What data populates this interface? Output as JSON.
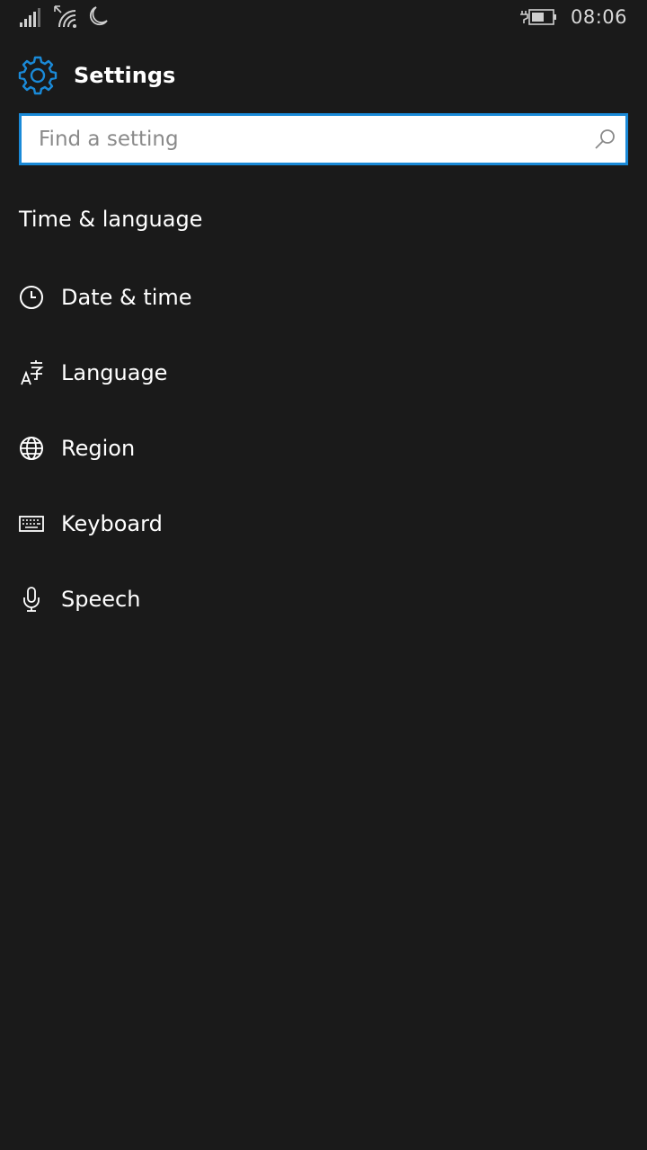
{
  "status": {
    "time": "08:06"
  },
  "header": {
    "title": "Settings"
  },
  "search": {
    "placeholder": "Find a setting",
    "value": ""
  },
  "section": {
    "title": "Time & language"
  },
  "menu": {
    "items": [
      {
        "label": "Date & time",
        "icon": "clock-icon"
      },
      {
        "label": "Language",
        "icon": "language-icon"
      },
      {
        "label": "Region",
        "icon": "globe-icon"
      },
      {
        "label": "Keyboard",
        "icon": "keyboard-icon"
      },
      {
        "label": "Speech",
        "icon": "microphone-icon"
      }
    ]
  },
  "colors": {
    "background": "#1a1a1a",
    "accent": "#1a8ad8",
    "text": "#ffffff"
  }
}
